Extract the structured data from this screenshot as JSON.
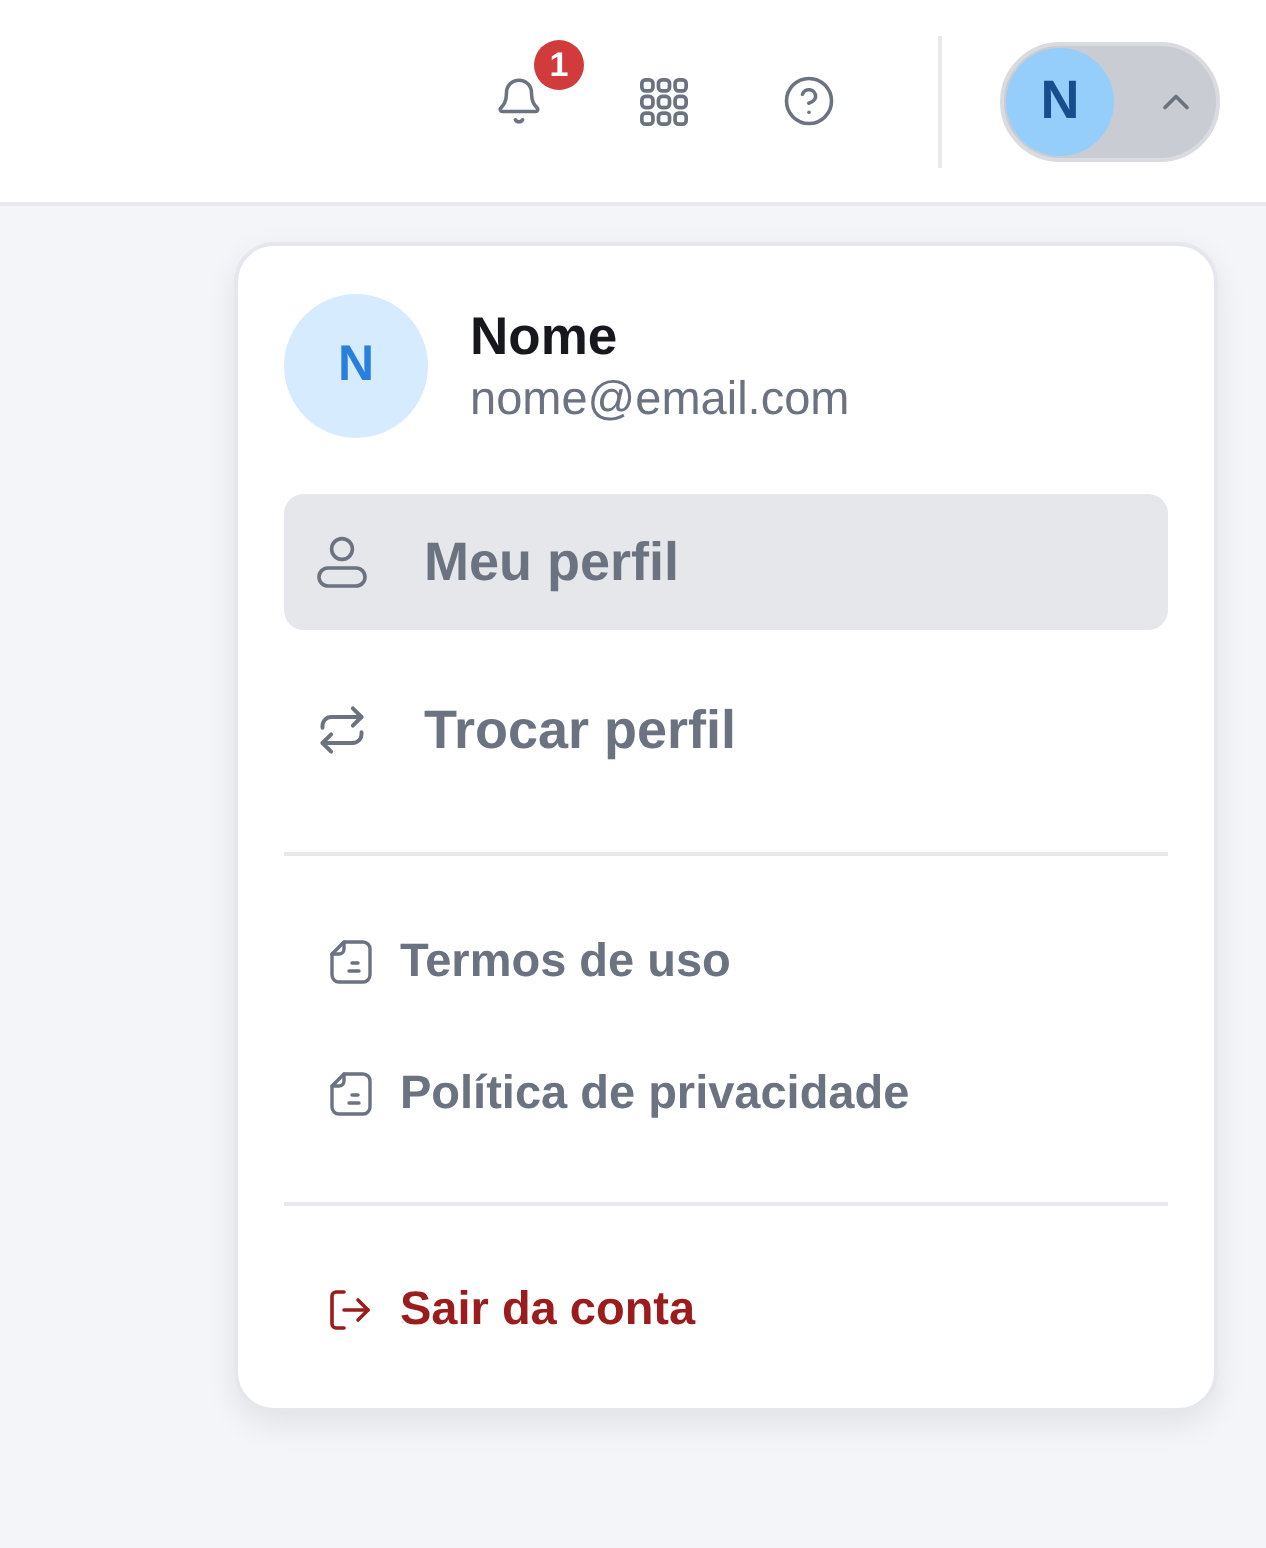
{
  "topbar": {
    "notifications": {
      "count": "1"
    },
    "profile_toggle": {
      "initial": "N",
      "expanded": true
    }
  },
  "profile_menu": {
    "user": {
      "initial": "N",
      "name": "Nome",
      "email": "nome@email.com"
    },
    "primary_items": [
      {
        "label": "Meu perfil",
        "selected": true
      },
      {
        "label": "Trocar perfil",
        "selected": false
      }
    ],
    "legal_items": [
      {
        "label": "Termos de uso"
      },
      {
        "label": "Política de privacidade"
      }
    ],
    "logout": {
      "label": "Sair da conta"
    }
  }
}
